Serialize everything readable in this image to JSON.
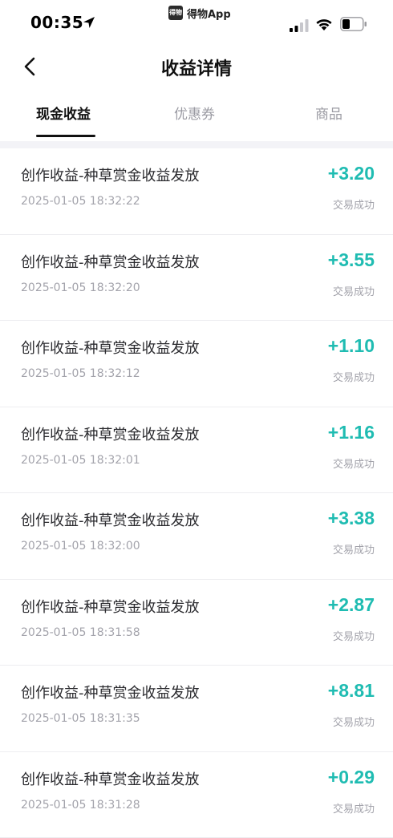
{
  "status_bar": {
    "time": "00:35",
    "app_name": "得物App",
    "app_logo_text": "得物"
  },
  "header": {
    "title": "收益详情"
  },
  "tabs": [
    {
      "label": "现金收益",
      "active": true
    },
    {
      "label": "优惠券",
      "active": false
    },
    {
      "label": "商品",
      "active": false
    }
  ],
  "colors": {
    "accent": "#1fbcb2",
    "muted": "#a3a3ab"
  },
  "transactions": [
    {
      "title": "创作收益-种草赏金收益发放",
      "time": "2025-01-05 18:32:22",
      "amount": "+3.20",
      "status": "交易成功"
    },
    {
      "title": "创作收益-种草赏金收益发放",
      "time": "2025-01-05 18:32:20",
      "amount": "+3.55",
      "status": "交易成功"
    },
    {
      "title": "创作收益-种草赏金收益发放",
      "time": "2025-01-05 18:32:12",
      "amount": "+1.10",
      "status": "交易成功"
    },
    {
      "title": "创作收益-种草赏金收益发放",
      "time": "2025-01-05 18:32:01",
      "amount": "+1.16",
      "status": "交易成功"
    },
    {
      "title": "创作收益-种草赏金收益发放",
      "time": "2025-01-05 18:32:00",
      "amount": "+3.38",
      "status": "交易成功"
    },
    {
      "title": "创作收益-种草赏金收益发放",
      "time": "2025-01-05 18:31:58",
      "amount": "+2.87",
      "status": "交易成功"
    },
    {
      "title": "创作收益-种草赏金收益发放",
      "time": "2025-01-05 18:31:35",
      "amount": "+8.81",
      "status": "交易成功"
    },
    {
      "title": "创作收益-种草赏金收益发放",
      "time": "2025-01-05 18:31:28",
      "amount": "+0.29",
      "status": "交易成功"
    }
  ]
}
